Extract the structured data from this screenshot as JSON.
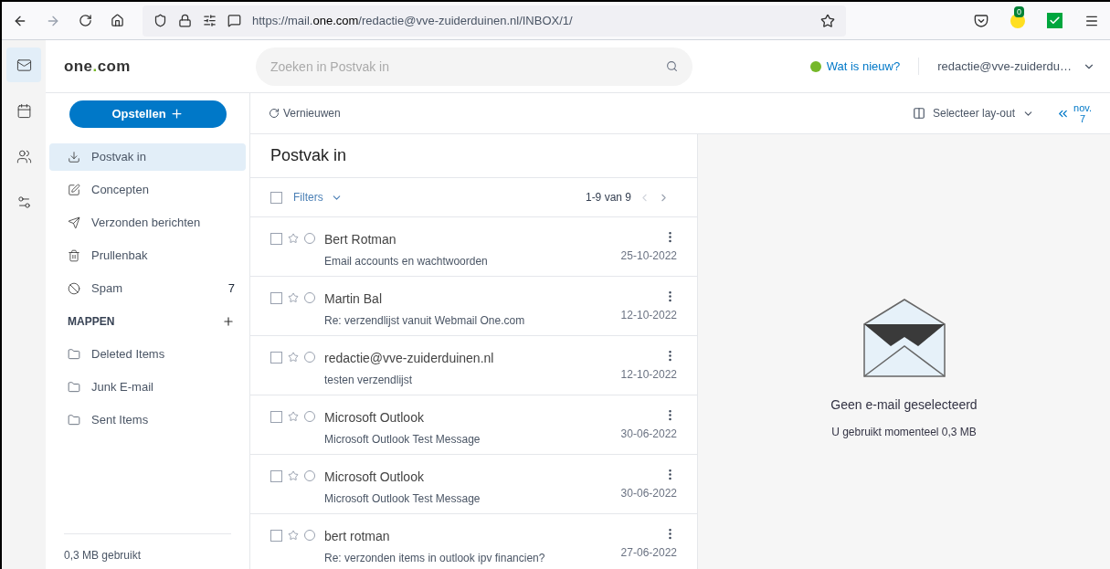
{
  "browser": {
    "url": "https://mail.**one.com**/redactie@vve-zuiderduinen.nl/INBOX/1/",
    "extension_badge": "0"
  },
  "rail": [
    {
      "kind": "mail",
      "selected": true
    },
    {
      "kind": "calendar",
      "selected": false
    },
    {
      "kind": "contacts",
      "selected": false
    },
    {
      "kind": "settings",
      "selected": false
    }
  ],
  "header": {
    "logo": {
      "before": "one",
      "dot": ".",
      "after": "com"
    },
    "search": {
      "placeholder": "Zoeken in Postvak in"
    },
    "whats_new": "Wat is nieuw?",
    "account": "redactie@vve-zuiderdu…"
  },
  "toolbar": {
    "compose": "Opstellen",
    "refresh": "Vernieuwen",
    "layout": "Selecteer lay-out",
    "date_month": "nov.",
    "date_day": "7"
  },
  "folders": [
    {
      "kind": "inbox",
      "label": "Postvak in",
      "selected": true
    },
    {
      "kind": "drafts",
      "label": "Concepten",
      "selected": false
    },
    {
      "kind": "sent",
      "label": "Verzonden berichten",
      "selected": false
    },
    {
      "kind": "trash",
      "label": "Prullenbak",
      "selected": false
    },
    {
      "kind": "spam",
      "label": "Spam",
      "selected": false,
      "count": "7"
    }
  ],
  "mappen": {
    "title": "MAPPEN",
    "items": [
      {
        "label": "Deleted Items",
        "selected": false
      },
      {
        "label": "Junk E-mail",
        "selected": false
      },
      {
        "label": "Sent Items",
        "selected": false
      }
    ]
  },
  "storage": "0,3 MB gebruikt",
  "list": {
    "title": "Postvak in",
    "select_all_checked": false,
    "filters": "Filters",
    "range": "1-9 van 9",
    "messages": [
      {
        "sender": "Bert Rotman",
        "subject": "Email accounts en wachtwoorden",
        "date": "25-10-2022",
        "checked": false,
        "starred": false
      },
      {
        "sender": "Martin Bal",
        "subject": "Re: verzendlijst vanuit Webmail One.com",
        "date": "12-10-2022",
        "checked": false,
        "starred": false
      },
      {
        "sender": "redactie@vve-zuiderduinen.nl",
        "subject": "testen verzendlijst",
        "date": "12-10-2022",
        "checked": false,
        "starred": false
      },
      {
        "sender": "Microsoft Outlook",
        "subject": "Microsoft Outlook Test Message",
        "date": "30-06-2022",
        "checked": false,
        "starred": false
      },
      {
        "sender": "Microsoft Outlook",
        "subject": "Microsoft Outlook Test Message",
        "date": "30-06-2022",
        "checked": false,
        "starred": false
      },
      {
        "sender": "bert rotman",
        "subject": "Re: verzonden items in outlook ipv financien?",
        "date": "27-06-2022",
        "checked": false,
        "starred": false
      }
    ]
  },
  "preview": {
    "title": "Geen e-mail geselecteerd",
    "usage": "U gebruikt momenteel 0,3 MB"
  }
}
